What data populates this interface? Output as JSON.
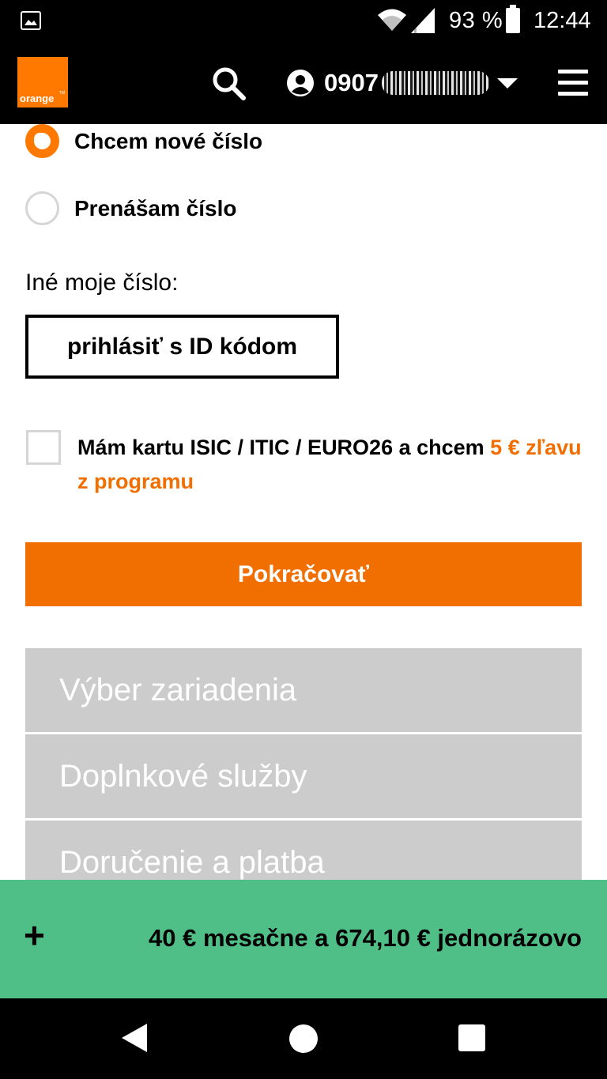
{
  "status_bar": {
    "battery_percent": "93 %",
    "time": "12:44"
  },
  "header": {
    "logo_text": "orange",
    "logo_tm": "TM",
    "account_number_visible": "0907"
  },
  "number_options": [
    {
      "label": "Chcem nové číslo",
      "selected": true
    },
    {
      "label": "Prenášam číslo",
      "selected": false
    }
  ],
  "other_number": {
    "label": "Iné moje číslo:",
    "button_label": "prihlásiť s ID kódom"
  },
  "isic": {
    "text_main": "Mám kartu ISIC / ITIC / EURO26 a chcem ",
    "text_highlight": "5 € zľavu z programu",
    "checked": false
  },
  "continue_label": "Pokračovať",
  "steps": [
    {
      "label": "Výber zariadenia"
    },
    {
      "label": "Doplnkové služby"
    },
    {
      "label": "Doručenie a platba"
    }
  ],
  "summary": {
    "expand_symbol": "+",
    "total": "40 € mesačne a 674,10 € jednorázovo"
  },
  "colors": {
    "brand_orange": "#f16e00",
    "logo_orange": "#ff7900",
    "summary_green": "#50be87",
    "step_grey": "#cccccc"
  }
}
